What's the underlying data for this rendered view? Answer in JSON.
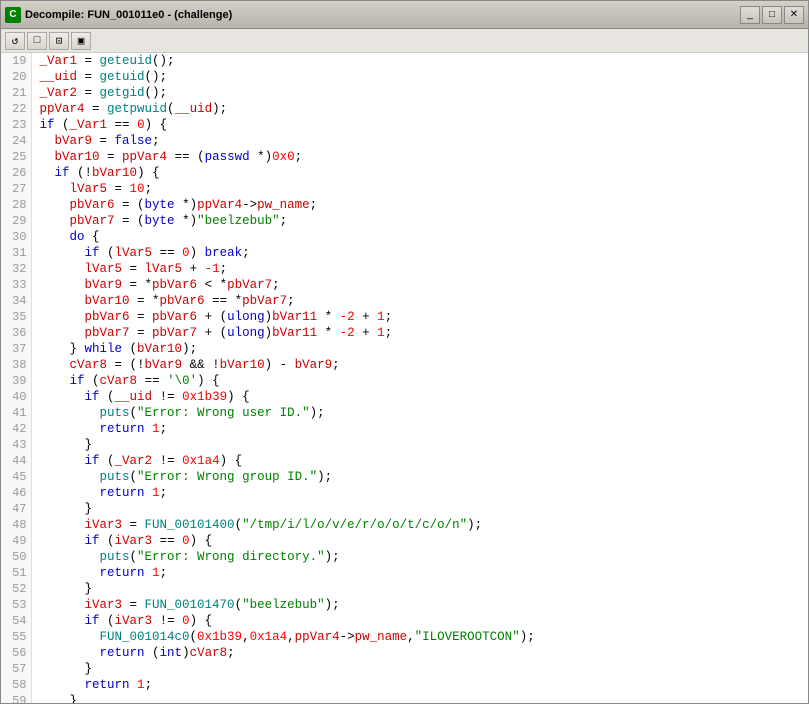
{
  "window": {
    "title": "Decompile: FUN_001011e0 - (challenge)",
    "icon_label": "C"
  },
  "toolbar": {
    "buttons": [
      "↺",
      "□",
      "⊡",
      "▣"
    ]
  },
  "code": {
    "lines": [
      {
        "num": 19,
        "html": "<span class='var'>_Var1</span> = <span class='fn'>geteuid</span>();"
      },
      {
        "num": 20,
        "html": "<span class='var'>__uid</span> = <span class='fn'>getuid</span>();"
      },
      {
        "num": 21,
        "html": "<span class='var'>_Var2</span> = <span class='fn'>getgid</span>();"
      },
      {
        "num": 22,
        "html": "<span class='var'>ppVar4</span> = <span class='fn'>getpwuid</span>(<span class='var'>__uid</span>);"
      },
      {
        "num": 23,
        "html": "<span class='kw'>if</span> (<span class='var'>_Var1</span> == <span class='num'>0</span>) {"
      },
      {
        "num": 24,
        "html": "  <span class='var'>bVar9</span> = <span class='kw'>false</span>;"
      },
      {
        "num": 25,
        "html": "  <span class='var'>bVar10</span> = <span class='var'>ppVar4</span> == (<span class='type'>passwd</span> *)<span class='num'>0x0</span>;"
      },
      {
        "num": 26,
        "html": "  <span class='kw'>if</span> (!<span class='var'>bVar10</span>) {"
      },
      {
        "num": 27,
        "html": "    <span class='var'>lVar5</span> = <span class='num'>10</span>;"
      },
      {
        "num": 28,
        "html": "    <span class='var'>pbVar6</span> = (<span class='type'>byte</span> *)<span class='var'>ppVar4</span>-&gt;<span class='var'>pw_name</span>;"
      },
      {
        "num": 29,
        "html": "    <span class='var'>pbVar7</span> = (<span class='type'>byte</span> *)<span class='str'>\"beelzebub\"</span>;"
      },
      {
        "num": 30,
        "html": "    <span class='kw'>do</span> {"
      },
      {
        "num": 31,
        "html": "      <span class='kw'>if</span> (<span class='var'>lVar5</span> == <span class='num'>0</span>) <span class='kw'>break</span>;"
      },
      {
        "num": 32,
        "html": "      <span class='var'>lVar5</span> = <span class='var'>lVar5</span> + <span class='num'>-1</span>;"
      },
      {
        "num": 33,
        "html": "      <span class='var'>bVar9</span> = *<span class='var'>pbVar6</span> &lt; *<span class='var'>pbVar7</span>;"
      },
      {
        "num": 34,
        "html": "      <span class='var'>bVar10</span> = *<span class='var'>pbVar6</span> == *<span class='var'>pbVar7</span>;"
      },
      {
        "num": 35,
        "html": "      <span class='var'>pbVar6</span> = <span class='var'>pbVar6</span> + (<span class='type'>ulong</span>)<span class='var'>bVar11</span> * <span class='num'>-2</span> + <span class='num'>1</span>;"
      },
      {
        "num": 36,
        "html": "      <span class='var'>pbVar7</span> = <span class='var'>pbVar7</span> + (<span class='type'>ulong</span>)<span class='var'>bVar11</span> * <span class='num'>-2</span> + <span class='num'>1</span>;"
      },
      {
        "num": 37,
        "html": "    } <span class='kw'>while</span> (<span class='var'>bVar10</span>);"
      },
      {
        "num": 38,
        "html": "    <span class='var'>cVar8</span> = (!<span class='var'>bVar9</span> &amp;&amp; !<span class='var'>bVar10</span>) - <span class='var'>bVar9</span>;"
      },
      {
        "num": 39,
        "html": "    <span class='kw'>if</span> (<span class='var'>cVar8</span> == <span class='str'>'\\0'</span>) {"
      },
      {
        "num": 40,
        "html": "      <span class='kw'>if</span> (<span class='var'>__uid</span> != <span class='num'>0x1b39</span>) {"
      },
      {
        "num": 41,
        "html": "        <span class='fn'>puts</span>(<span class='str'>\"Error: Wrong user ID.\"</span>);"
      },
      {
        "num": 42,
        "html": "        <span class='kw'>return</span> <span class='num'>1</span>;"
      },
      {
        "num": 43,
        "html": "      }"
      },
      {
        "num": 44,
        "html": "      <span class='kw'>if</span> (<span class='var'>_Var2</span> != <span class='num'>0x1a4</span>) {"
      },
      {
        "num": 45,
        "html": "        <span class='fn'>puts</span>(<span class='str'>\"Error: Wrong group ID.\"</span>);"
      },
      {
        "num": 46,
        "html": "        <span class='kw'>return</span> <span class='num'>1</span>;"
      },
      {
        "num": 47,
        "html": "      }"
      },
      {
        "num": 48,
        "html": "      <span class='var'>iVar3</span> = <span class='fn'>FUN_00101400</span>(<span class='str'>\"/tmp/i/l/o/v/e/r/o/o/t/c/o/n\"</span>);"
      },
      {
        "num": 49,
        "html": "      <span class='kw'>if</span> (<span class='var'>iVar3</span> == <span class='num'>0</span>) {"
      },
      {
        "num": 50,
        "html": "        <span class='fn'>puts</span>(<span class='str'>\"Error: Wrong directory.\"</span>);"
      },
      {
        "num": 51,
        "html": "        <span class='kw'>return</span> <span class='num'>1</span>;"
      },
      {
        "num": 52,
        "html": "      }"
      },
      {
        "num": 53,
        "html": "      <span class='var'>iVar3</span> = <span class='fn'>FUN_00101470</span>(<span class='str'>\"beelzebub\"</span>);"
      },
      {
        "num": 54,
        "html": "      <span class='kw'>if</span> (<span class='var'>iVar3</span> != <span class='num'>0</span>) {"
      },
      {
        "num": 55,
        "html": "        <span class='fn'>FUN_001014c0</span>(<span class='num'>0x1b39</span>,<span class='num'>0x1a4</span>,<span class='var'>ppVar4</span>-&gt;<span class='var'>pw_name</span>,<span class='str'>\"ILOVEROOTCON\"</span>);"
      },
      {
        "num": 56,
        "html": "        <span class='kw'>return</span> (<span class='type'>int</span>)<span class='var'>cVar8</span>;"
      },
      {
        "num": 57,
        "html": "      }"
      },
      {
        "num": 58,
        "html": "      <span class='kw'>return</span> <span class='num'>1</span>;"
      },
      {
        "num": 59,
        "html": "    }"
      }
    ]
  }
}
